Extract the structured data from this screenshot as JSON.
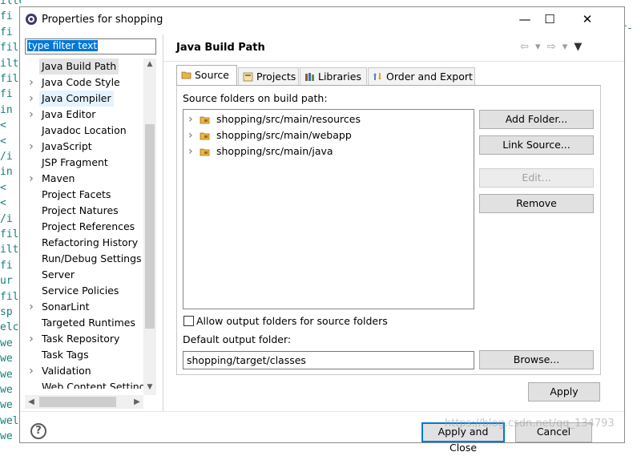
{
  "background_editor": {
    "lines": [
      "ilter>",
      "fi",
      "fi",
      "fil",
      "ilt",
      "fil",
      "fi",
      "in",
      "<",
      "<",
      "/i",
      "in",
      "<",
      "<",
      "/i",
      "fil",
      "ilt",
      "fi",
      "ur",
      "fil",
      "sp",
      "elc",
      "we",
      "we",
      "we",
      "we",
      "we",
      "wel",
      "we"
    ],
    "right_text": "ter-"
  },
  "window": {
    "title": "Properties for shopping",
    "minimize": "—",
    "maximize": "☐",
    "close": "✕"
  },
  "filter": {
    "value": "type filter text"
  },
  "tree": {
    "items": [
      {
        "label": "Java Build Path",
        "arrow": "",
        "state": "selected"
      },
      {
        "label": "Java Code Style",
        "arrow": "›",
        "state": ""
      },
      {
        "label": "Java Compiler",
        "arrow": "›",
        "state": "hover"
      },
      {
        "label": "Java Editor",
        "arrow": "›",
        "state": ""
      },
      {
        "label": "Javadoc Location",
        "arrow": "",
        "state": ""
      },
      {
        "label": "JavaScript",
        "arrow": "›",
        "state": ""
      },
      {
        "label": "JSP Fragment",
        "arrow": "",
        "state": ""
      },
      {
        "label": "Maven",
        "arrow": "›",
        "state": ""
      },
      {
        "label": "Project Facets",
        "arrow": "",
        "state": ""
      },
      {
        "label": "Project Natures",
        "arrow": "",
        "state": ""
      },
      {
        "label": "Project References",
        "arrow": "",
        "state": ""
      },
      {
        "label": "Refactoring History",
        "arrow": "",
        "state": ""
      },
      {
        "label": "Run/Debug Settings",
        "arrow": "",
        "state": ""
      },
      {
        "label": "Server",
        "arrow": "",
        "state": ""
      },
      {
        "label": "Service Policies",
        "arrow": "",
        "state": ""
      },
      {
        "label": "SonarLint",
        "arrow": "›",
        "state": ""
      },
      {
        "label": "Targeted Runtimes",
        "arrow": "",
        "state": ""
      },
      {
        "label": "Task Repository",
        "arrow": "›",
        "state": ""
      },
      {
        "label": "Task Tags",
        "arrow": "",
        "state": ""
      },
      {
        "label": "Validation",
        "arrow": "›",
        "state": ""
      },
      {
        "label": "Web Content Settings",
        "arrow": "",
        "state": ""
      }
    ]
  },
  "page": {
    "title": "Java Build Path",
    "tabs": [
      {
        "label": "Source",
        "active": true
      },
      {
        "label": "Projects",
        "active": false
      },
      {
        "label": "Libraries",
        "active": false
      },
      {
        "label": "Order and Export",
        "active": false
      }
    ],
    "source_folders_label": "Source folders on build path:",
    "source_folders": [
      "shopping/src/main/resources",
      "shopping/src/main/webapp",
      "shopping/src/main/java"
    ],
    "buttons": {
      "add_folder": "Add Folder...",
      "link_source": "Link Source...",
      "edit": "Edit...",
      "remove": "Remove",
      "browse": "Browse..."
    },
    "allow_output_label": "Allow output folders for source folders",
    "default_output_label": "Default output folder:",
    "default_output_value": "shopping/target/classes",
    "apply": "Apply"
  },
  "footer": {
    "help": "?",
    "apply_and_close": "Apply and Close",
    "cancel": "Cancel",
    "watermark": "https://blog.csdn.net/qq_134793"
  },
  "colors": {
    "selection_blue": "#0078d7",
    "button_face": "#e1e1e1"
  }
}
